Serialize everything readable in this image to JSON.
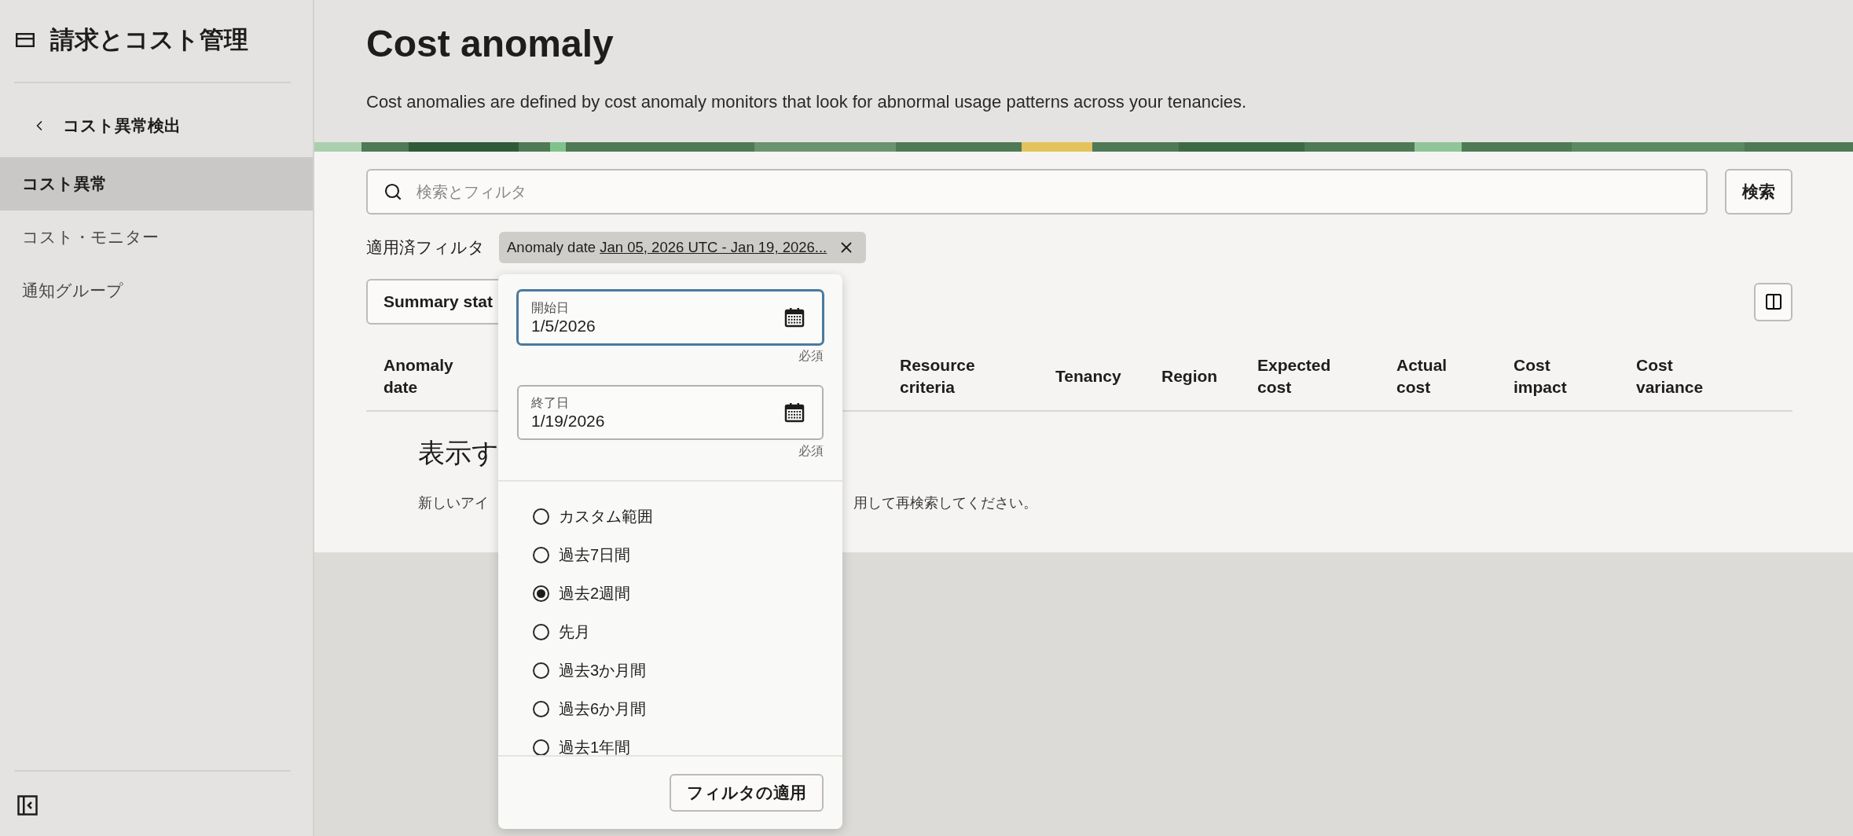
{
  "sidebar": {
    "title": "請求とコスト管理",
    "back_link": "コスト異常検出",
    "items": [
      {
        "label": "コスト異常",
        "selected": true
      },
      {
        "label": "コスト・モニター",
        "selected": false
      },
      {
        "label": "通知グループ",
        "selected": false
      }
    ]
  },
  "page": {
    "title": "Cost anomaly",
    "description": "Cost anomalies are defined by cost anomaly monitors that look for abnormal usage patterns across your tenancies."
  },
  "search": {
    "placeholder": "検索とフィルタ",
    "button": "検索"
  },
  "applied_filters": {
    "label": "適用済フィルタ",
    "chips": [
      {
        "name": "Anomaly date",
        "value": "Jan 05, 2026 UTC - Jan 19, 2026..."
      }
    ]
  },
  "toolbar": {
    "summary_button": "Summary stat"
  },
  "table": {
    "columns": [
      "Anomaly date",
      "Resource criteria",
      "Tenancy",
      "Region",
      "Expected cost",
      "Actual cost",
      "Cost impact",
      "Cost variance"
    ]
  },
  "empty_state": {
    "heading": "表示す",
    "message_parts": [
      "新しいアイ",
      "用して再検索してください。"
    ]
  },
  "date_popup": {
    "fields": [
      {
        "label": "開始日",
        "value": "1/5/2026",
        "hint": "必須",
        "focused": true
      },
      {
        "label": "終了日",
        "value": "1/19/2026",
        "hint": "必須",
        "focused": false
      }
    ],
    "presets": [
      {
        "label": "カスタム範囲",
        "selected": false
      },
      {
        "label": "過去7日間",
        "selected": false
      },
      {
        "label": "過去2週間",
        "selected": true
      },
      {
        "label": "先月",
        "selected": false
      },
      {
        "label": "過去3か月間",
        "selected": false
      },
      {
        "label": "過去6か月間",
        "selected": false
      },
      {
        "label": "過去1年間",
        "selected": false
      }
    ],
    "apply_button": "フィルタの適用"
  }
}
